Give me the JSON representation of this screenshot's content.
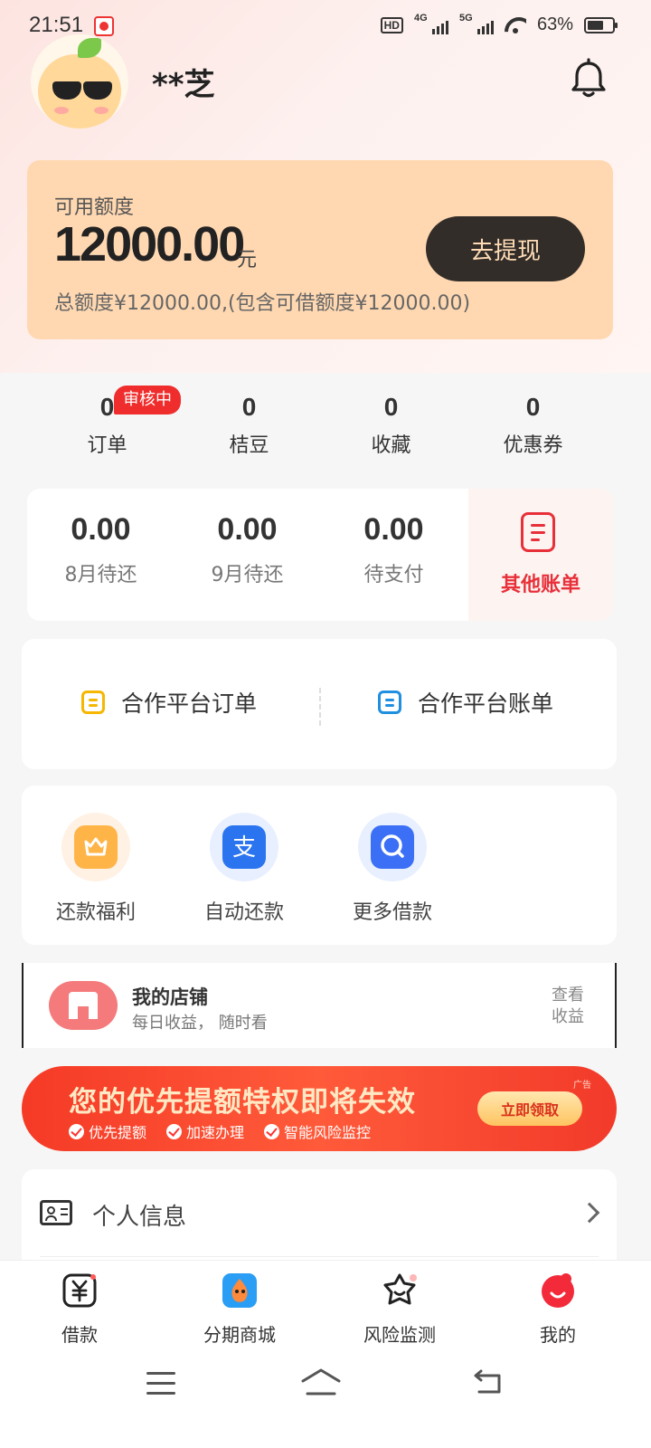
{
  "status_bar": {
    "time": "21:51",
    "battery": "63%",
    "net1": "4G",
    "net2": "5G",
    "hd": "HD"
  },
  "user": {
    "name": "**芝"
  },
  "credit": {
    "label": "可用额度",
    "amount": "12000.00",
    "unit": "元",
    "total_text": "总额度¥12000.00,(包含可借额度¥12000.00)",
    "withdraw_label": "去提现"
  },
  "stats": [
    {
      "value": "0",
      "label": "订单"
    },
    {
      "value": "0",
      "label": "桔豆"
    },
    {
      "value": "0",
      "label": "收藏"
    },
    {
      "value": "0",
      "label": "优惠券"
    }
  ],
  "review_badge": "审核中",
  "bills": [
    {
      "value": "0.00",
      "label": "8月待还"
    },
    {
      "value": "0.00",
      "label": "9月待还"
    },
    {
      "value": "0.00",
      "label": "待支付"
    }
  ],
  "other_bill_label": "其他账单",
  "partner": {
    "orders_label": "合作平台订单",
    "bills_label": "合作平台账单"
  },
  "services": [
    {
      "label": "还款福利"
    },
    {
      "label": "自动还款"
    },
    {
      "label": "更多借款"
    }
  ],
  "shop": {
    "title": "我的店铺",
    "subtitle": "每日收益， 随时看",
    "link": "查看收益"
  },
  "promo": {
    "title": "您的优先提额特权即将失效",
    "features": [
      "优先提额",
      "加速办理",
      "智能风险监控"
    ],
    "button": "立即领取",
    "ad": "广告"
  },
  "personal_info_label": "个人信息",
  "tabs": [
    {
      "label": "借款"
    },
    {
      "label": "分期商城"
    },
    {
      "label": "风险监测"
    },
    {
      "label": "我的"
    }
  ],
  "colors": {
    "accent_red": "#e8303a",
    "credit_bg": "#ffd8b1",
    "withdraw_bg": "#322d29"
  }
}
